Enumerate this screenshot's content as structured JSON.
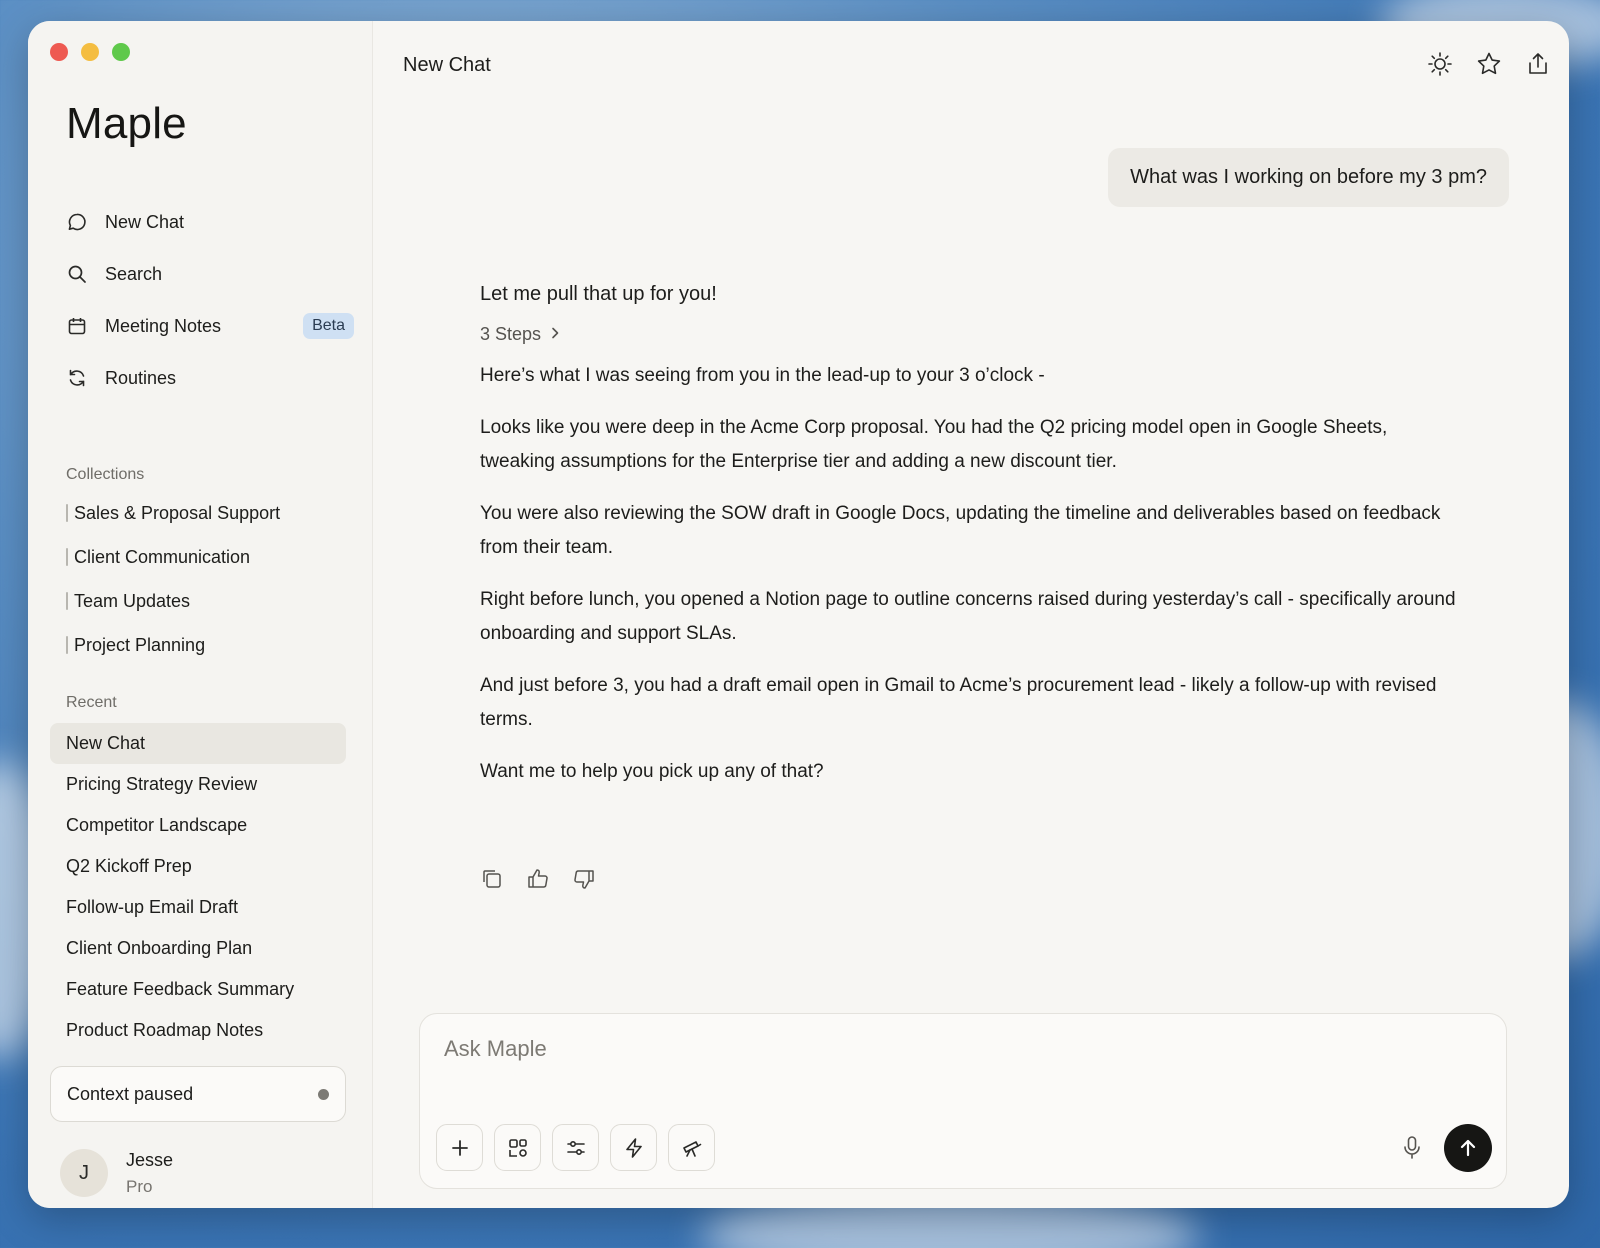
{
  "app": {
    "title": "Maple"
  },
  "nav": [
    {
      "label": "New Chat",
      "icon": "chat-bubble-icon"
    },
    {
      "label": "Search",
      "icon": "search-icon"
    },
    {
      "label": "Meeting Notes",
      "icon": "calendar-icon",
      "badge": "Beta"
    },
    {
      "label": "Routines",
      "icon": "refresh-icon"
    }
  ],
  "collections": {
    "label": "Collections",
    "items": [
      "Sales & Proposal Support",
      "Client Communication",
      "Team Updates",
      "Project Planning"
    ]
  },
  "recent": {
    "label": "Recent",
    "active_index": 0,
    "items": [
      "New Chat",
      "Pricing Strategy Review",
      "Competitor Landscape",
      "Q2 Kickoff Prep",
      "Follow-up Email Draft",
      "Client Onboarding Plan",
      "Feature Feedback Summary",
      "Product Roadmap Notes"
    ]
  },
  "context": {
    "label": "Context paused"
  },
  "user": {
    "initial": "J",
    "name": "Jesse",
    "plan": "Pro"
  },
  "header": {
    "title": "New Chat",
    "icons": [
      "sun-icon",
      "star-icon",
      "share-icon"
    ]
  },
  "conversation": {
    "user_message": "What was I working on before my 3 pm?",
    "assistant_intro": "Let me pull that up for you!",
    "steps_label": "3 Steps",
    "paragraphs": [
      "Here’s what I was seeing from you in the lead-up to your 3 o’clock -",
      "Looks like you were deep in the Acme Corp proposal. You had the Q2 pricing model open in Google Sheets, tweaking assumptions for the Enterprise tier and adding a new discount tier.",
      "You were also reviewing the SOW draft in Google Docs, updating the timeline and deliverables based on feedback from their team.",
      "Right before lunch, you opened a Notion page to outline concerns raised during yesterday’s call - specifically around onboarding and support SLAs.",
      "And just before 3, you had a draft email open in Gmail to Acme’s procurement lead - likely a follow-up with revised terms.",
      "Want me to help you pick up any of that?"
    ]
  },
  "composer": {
    "placeholder": "Ask Maple",
    "tools": [
      "plus-icon",
      "layout-icon",
      "sliders-icon",
      "lightning-icon",
      "telescope-icon"
    ]
  },
  "colors": {
    "accent": "#161614",
    "badge_bg": "#cfe0f3",
    "active_item_bg": "#e9e7e1"
  }
}
